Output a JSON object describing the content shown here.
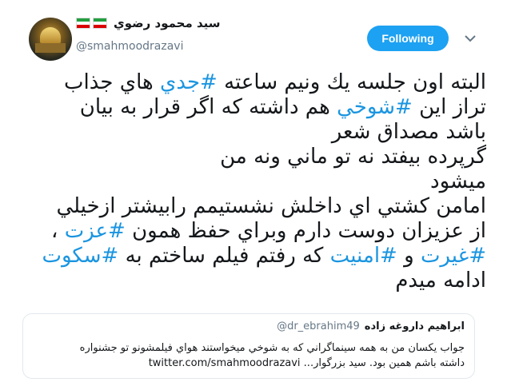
{
  "author": {
    "display_name": "سيد محمود رضوي",
    "handle": "@smahmoodrazavi",
    "flag_count": 2,
    "flag_colors": [
      "#239f40",
      "#ffffff",
      "#da0000"
    ]
  },
  "actions": {
    "follow_label": "Following",
    "menu_icon": "chevron-down-icon",
    "accent_color": "#1da1f2"
  },
  "tweet": {
    "lines": [
      [
        {
          "t": "البته اون جلسه يك ونيم ساعته "
        },
        {
          "h": "#جدي"
        },
        {
          "t": " هاي جذاب"
        }
      ],
      [
        {
          "t": "تراز اين "
        },
        {
          "h": "#شوخي"
        },
        {
          "t": " هم داشته كه اگر قرار به بيان"
        }
      ],
      [
        {
          "t": "باشد مصداق شعر"
        }
      ],
      [
        {
          "t": "گرپرده بيفتد نه تو ماني ونه من"
        }
      ],
      [
        {
          "t": "ميشود"
        }
      ],
      [
        {
          "t": "امامن كشتي اي داخلش نشستيمم رابيشتر ازخيلي"
        }
      ],
      [
        {
          "t": "از عزيزان دوست دارم وبراي حفظ همون "
        },
        {
          "h": "#عزت"
        },
        {
          "t": " ،"
        }
      ],
      [
        {
          "h": "#غيرت"
        },
        {
          "t": " و "
        },
        {
          "h": "#امنيت"
        },
        {
          "t": " كه رفتم فيلم ساختم به "
        },
        {
          "h": "#سكوت"
        }
      ],
      [
        {
          "t": "ادامه ميدم"
        }
      ]
    ],
    "hashtag_color": "#1b95e0"
  },
  "quote": {
    "name": "ابراهيم داروغه زاده",
    "handle": "@dr_ebrahim49",
    "lines": [
      "جواب يكسان من به همه سينماگراني كه به شوخي ميخواستند هواي فيلمشونو تو جشنواره",
      "داشته باشم همين بود.  سيد بزرگوار... twitter.com/smahmoodrazavi"
    ]
  }
}
